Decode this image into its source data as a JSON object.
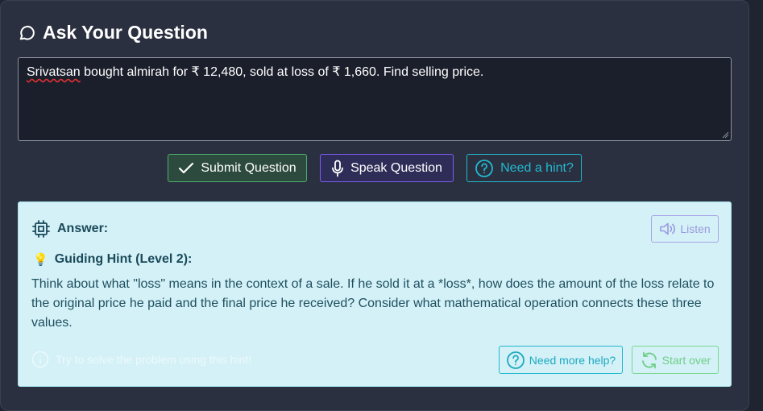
{
  "header": {
    "title": "Ask Your Question",
    "icon": "chat-bubble-icon"
  },
  "question": {
    "value_misspelled": "Srivatsan",
    "value_rest": " bought almirah for ₹ 12,480, sold at loss of ₹ 1,660. Find selling price."
  },
  "actions": {
    "submit_label": "Submit Question",
    "speak_label": "Speak Question",
    "hint_label": "Need a hint?"
  },
  "answer": {
    "label": "Answer:",
    "listen_label": "Listen",
    "hint_icon": "💡",
    "hint_title": "Guiding Hint (Level 2):",
    "hint_text": "Think about what \"loss\" means in the context of a sale. If he sold it at a *loss*, how does the amount of the loss relate to the original price he paid and the final price he received? Consider what mathematical operation connects these three values.",
    "footer_note": "Try to solve the problem using this hint!",
    "more_help_label": "Need more help?",
    "start_over_label": "Start over"
  },
  "colors": {
    "submit_border": "#4caf6e",
    "speak_border": "#7b5cf0",
    "hint_accent": "#22b8cf",
    "answer_bg": "#d3f1f7"
  }
}
